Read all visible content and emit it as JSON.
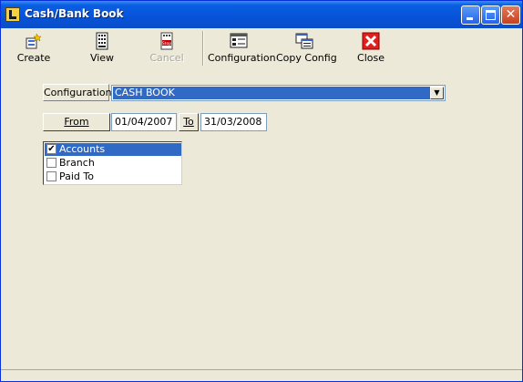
{
  "window": {
    "title": "Cash/Bank Book"
  },
  "toolbar": {
    "create": "Create",
    "view": "View",
    "cancel": "Cancel",
    "configuration": "Configuration",
    "copy_config": "Copy Config",
    "close": "Close"
  },
  "form": {
    "configuration_label": "Configuration",
    "configuration_value": "CASH BOOK",
    "from_label": "From",
    "from_date": "01/04/2007",
    "to_label": "To",
    "to_date": "31/03/2008"
  },
  "list": {
    "items": [
      {
        "label": "Accounts",
        "checked": true,
        "selected": true
      },
      {
        "label": "Branch",
        "checked": false,
        "selected": false
      },
      {
        "label": "Paid To",
        "checked": false,
        "selected": false
      }
    ]
  },
  "colors": {
    "selection": "#316ac5",
    "titlebar": "#0a5fe3",
    "close_red": "#e0201b"
  }
}
